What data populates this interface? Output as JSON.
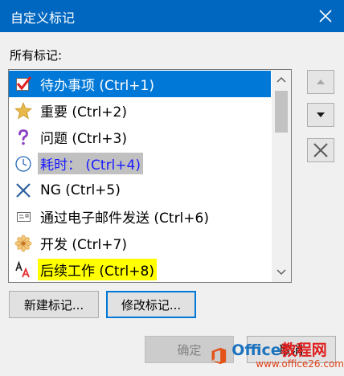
{
  "window": {
    "title": "自定义标记"
  },
  "list_label": "所有标记:",
  "tags": [
    {
      "label": "待办事项 (Ctrl+1)",
      "icon": "checkbox-checked-icon",
      "selected": true
    },
    {
      "label": "重要 (Ctrl+2)",
      "icon": "star-icon"
    },
    {
      "label": "问题 (Ctrl+3)",
      "icon": "question-mark-icon"
    },
    {
      "label": "耗时： (Ctrl+4)",
      "icon": "clock-icon",
      "highlight": "grey"
    },
    {
      "label": "NG (Ctrl+5)",
      "icon": "x-mark-icon"
    },
    {
      "label": "通过电子邮件发送 (Ctrl+6)",
      "icon": "email-card-icon"
    },
    {
      "label": "开发 (Ctrl+7)",
      "icon": "flower-icon"
    },
    {
      "label": "后续工作 (Ctrl+8)",
      "icon": "font-color-icon",
      "highlight": "yellow"
    }
  ],
  "buttons": {
    "new_tag": "新建标记...",
    "modify_tag": "修改标记...",
    "ok": "确定",
    "cancel": "取消"
  },
  "watermark": {
    "text_a": "Office",
    "text_b": "教程网",
    "url": "www.office26.com"
  },
  "colors": {
    "titlebar": "#0067c0",
    "selection": "#0078d7",
    "highlight_yellow": "#ffff00",
    "highlight_grey": "#c0c0c0"
  }
}
